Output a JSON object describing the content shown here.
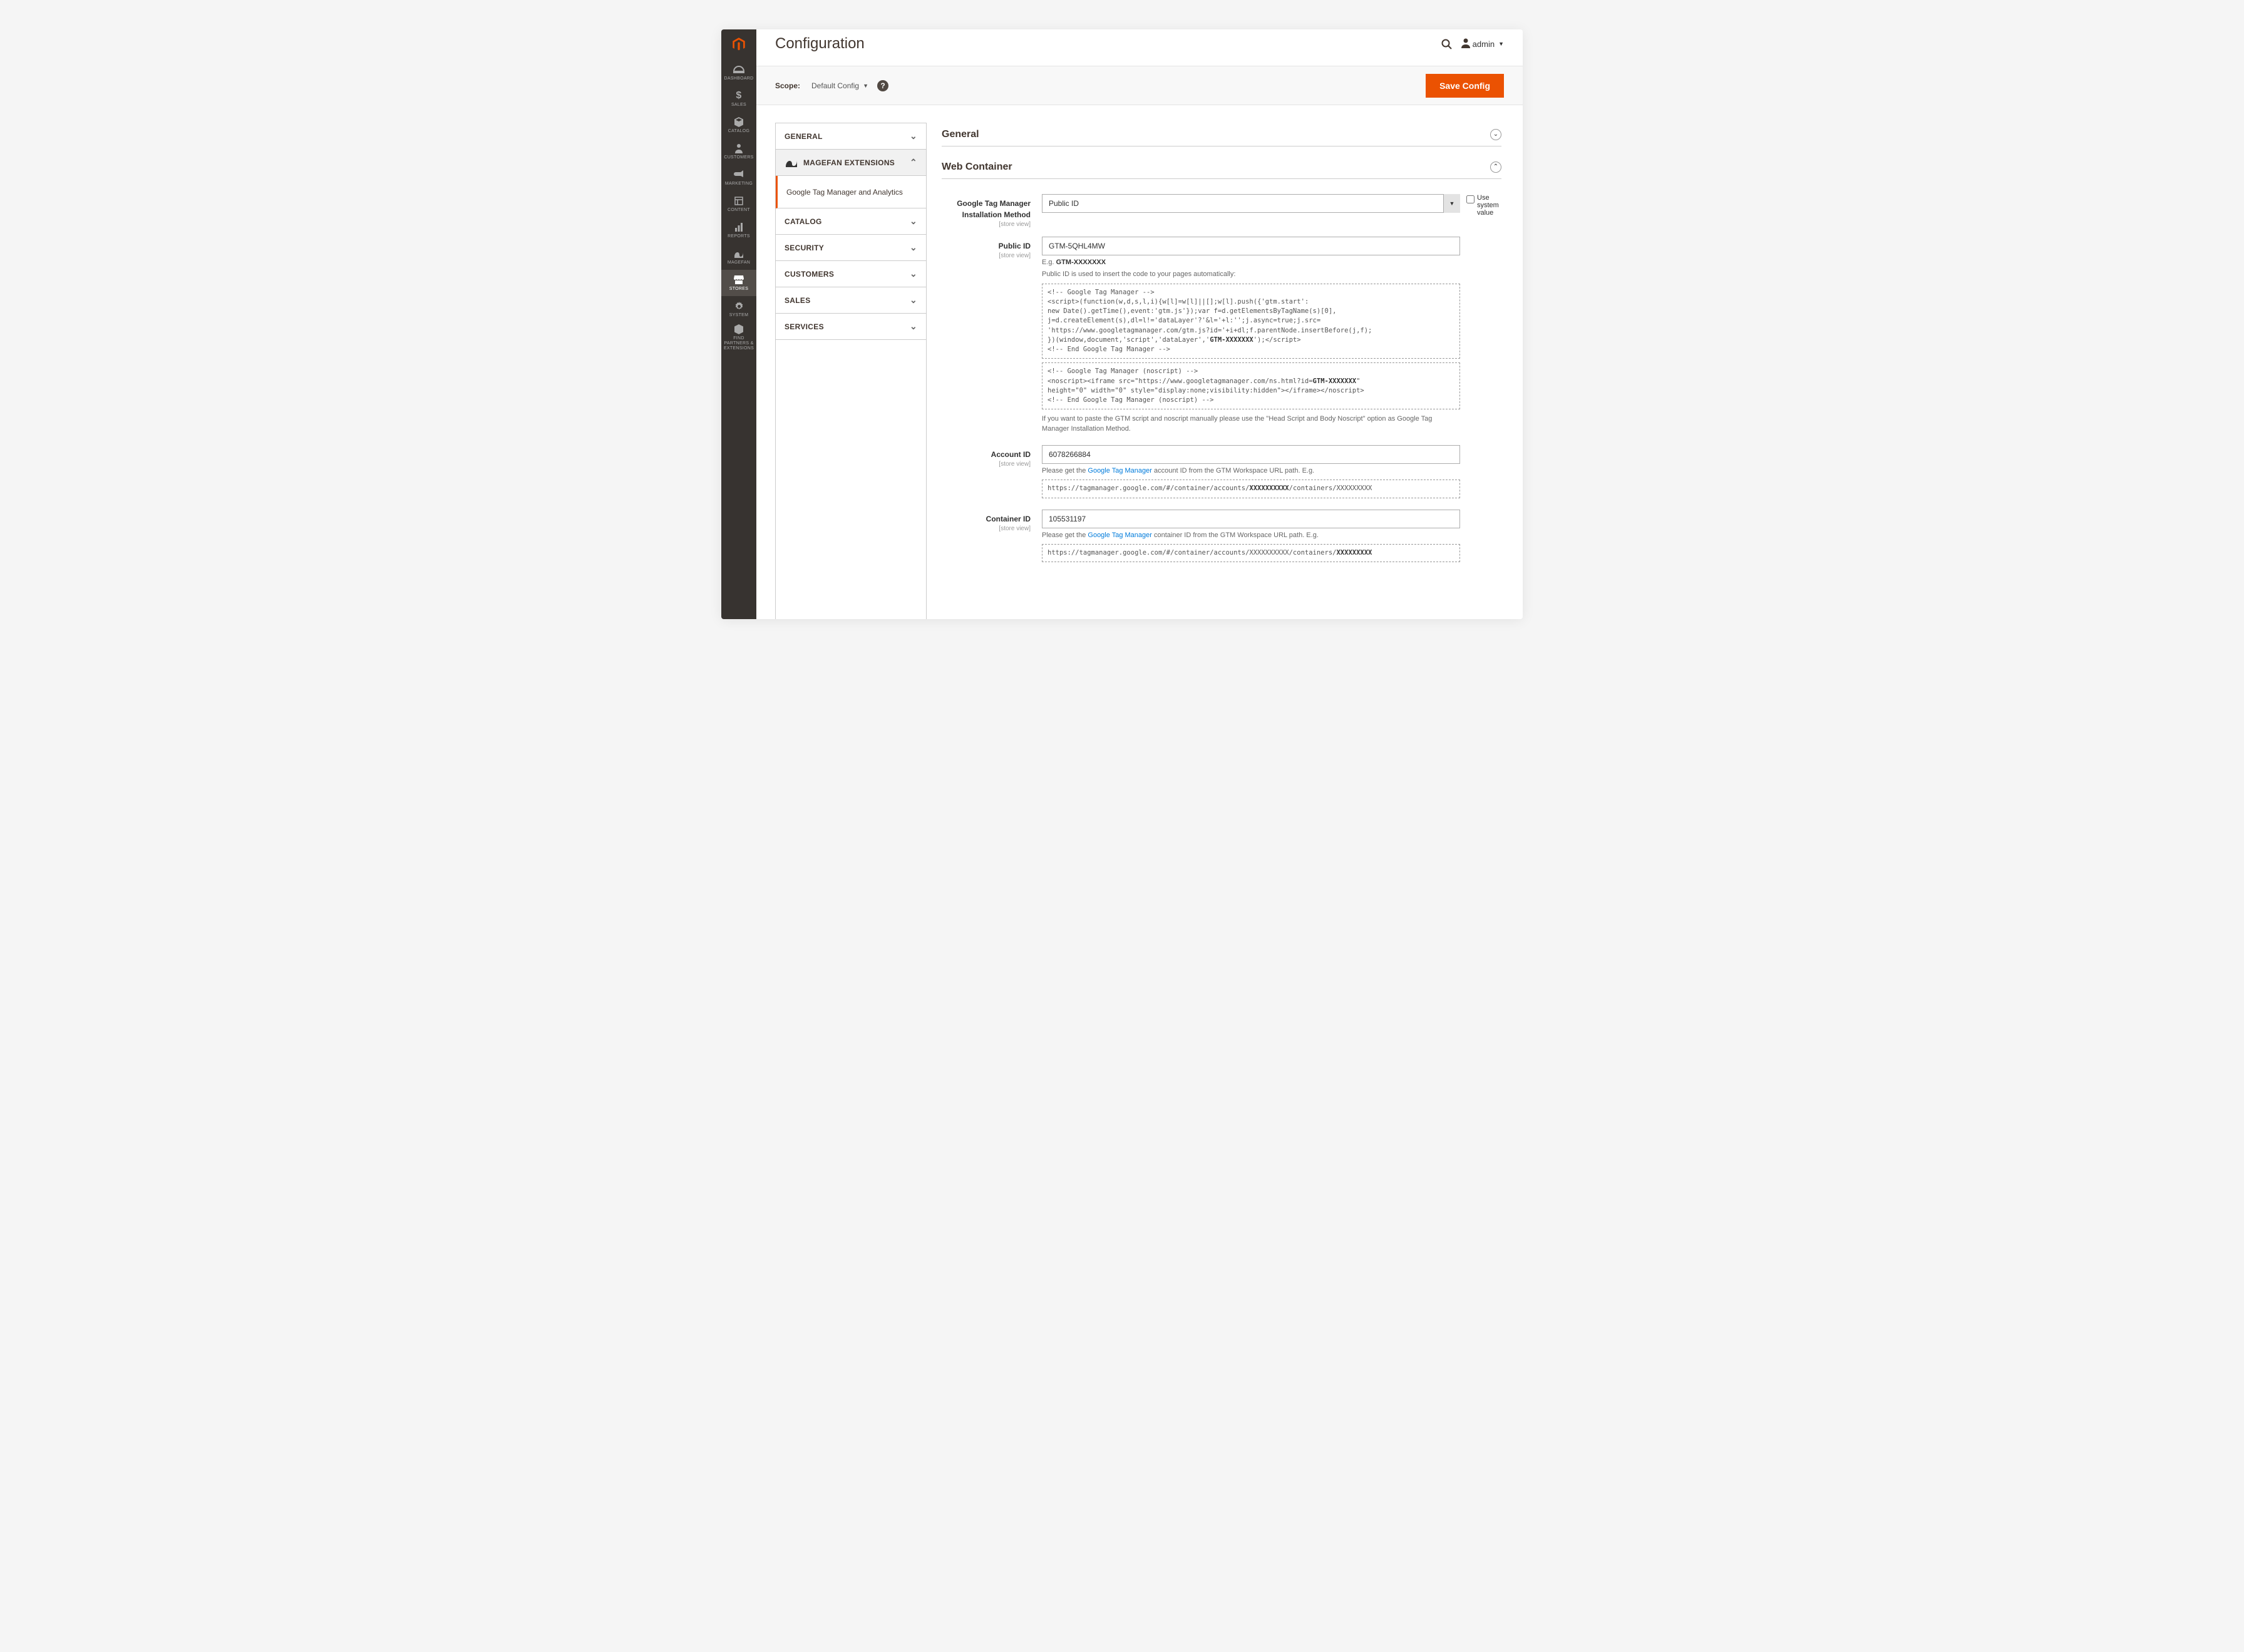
{
  "page_title": "Configuration",
  "user_label": "admin",
  "scope": {
    "label": "Scope:",
    "value": "Default Config"
  },
  "save_button": "Save Config",
  "nav": [
    {
      "label": "DASHBOARD"
    },
    {
      "label": "SALES"
    },
    {
      "label": "CATALOG"
    },
    {
      "label": "CUSTOMERS"
    },
    {
      "label": "MARKETING"
    },
    {
      "label": "CONTENT"
    },
    {
      "label": "REPORTS"
    },
    {
      "label": "MAGEFAN"
    },
    {
      "label": "STORES"
    },
    {
      "label": "SYSTEM"
    },
    {
      "label": "FIND PARTNERS & EXTENSIONS"
    }
  ],
  "tabs": {
    "general": "GENERAL",
    "magefan": "MAGEFAN EXTENSIONS",
    "magefan_sub": "Google Tag Manager and Analytics",
    "catalog": "CATALOG",
    "security": "SECURITY",
    "customers": "CUSTOMERS",
    "sales": "SALES",
    "services": "SERVICES"
  },
  "sections": {
    "general": "General",
    "web": "Web Container"
  },
  "fields": {
    "install_method": {
      "label": "Google Tag Manager Installation Method",
      "scope": "[store view]",
      "value": "Public ID",
      "use_system_label": "Use system value"
    },
    "public_id": {
      "label": "Public ID",
      "scope": "[store view]",
      "value": "GTM-5QHL4MW",
      "hint_1_pre": "E.g. ",
      "hint_1_bold": "GTM-XXXXXXX",
      "hint_2": "Public ID is used to insert the code to your pages automatically:",
      "code_1_a": "<!-- Google Tag Manager -->\n<script>(function(w,d,s,l,i){w[l]=w[l]||[];w[l].push({'gtm.start':\nnew Date().getTime(),event:'gtm.js'});var f=d.getElementsByTagName(s)[0],\nj=d.createElement(s),dl=l!='dataLayer'?'&l='+l:'';j.async=true;j.src=\n'https://www.googletagmanager.com/gtm.js?id='+i+dl;f.parentNode.insertBefore(j,f);\n})(window,document,'script','dataLayer','",
      "code_1_bold": "GTM-XXXXXXX",
      "code_1_b": "');</script>\n<!-- End Google Tag Manager -->",
      "code_2_a": "<!-- Google Tag Manager (noscript) -->\n<noscript><iframe src=\"https://www.googletagmanager.com/ns.html?id=",
      "code_2_bold": "GTM-XXXXXXX",
      "code_2_b": "\"\nheight=\"0\" width=\"0\" style=\"display:none;visibility:hidden\"></iframe></noscript>\n<!-- End Google Tag Manager (noscript) -->",
      "hint_3": "If you want to paste the GTM script and noscript manually please use the \"Head Script and Body Noscript\" option as Google Tag Manager Installation Method."
    },
    "account_id": {
      "label": "Account ID",
      "scope": "[store view]",
      "value": "6078266884",
      "hint_pre": "Please get the ",
      "link": "Google Tag Manager",
      "hint_post": " account ID from the GTM Workspace URL path. E.g.",
      "code_a": "https://tagmanager.google.com/#/container/accounts/",
      "code_bold": "XXXXXXXXXX",
      "code_b": "/containers/XXXXXXXXX"
    },
    "container_id": {
      "label": "Container ID",
      "scope": "[store view]",
      "value": "105531197",
      "hint_pre": "Please get the ",
      "link": "Google Tag Manager",
      "hint_post": " container ID from the GTM Workspace URL path. E.g.",
      "code_a": "https://tagmanager.google.com/#/container/accounts/XXXXXXXXXX/containers/",
      "code_bold": "XXXXXXXXX"
    }
  }
}
